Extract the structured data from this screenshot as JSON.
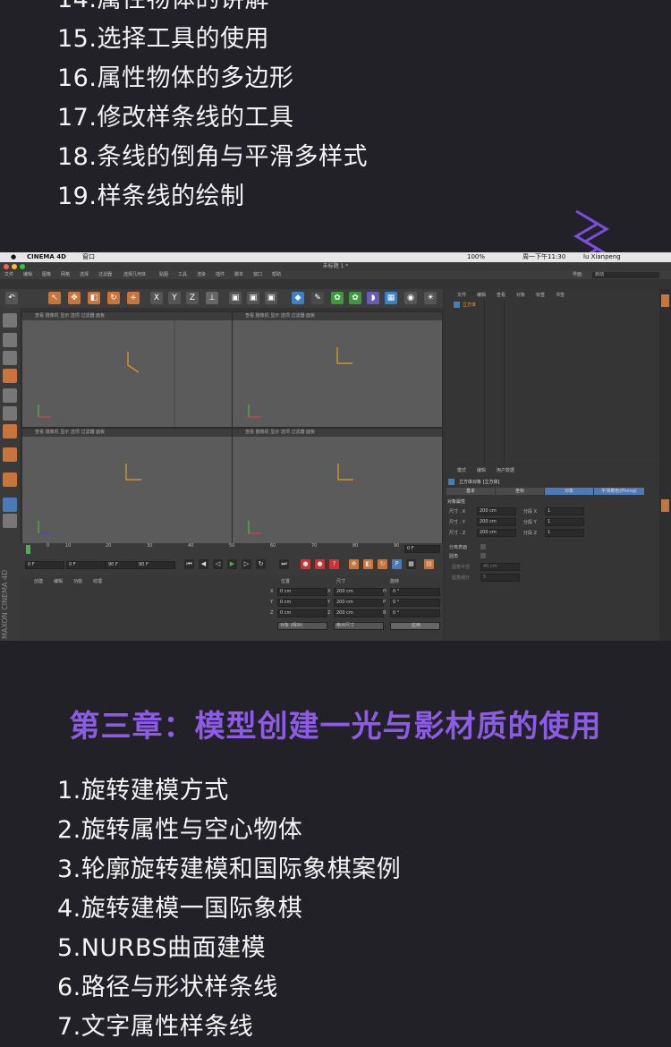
{
  "top_list": [
    "14.属性物体的讲解",
    "15.选择工具的使用",
    "16.属性物体的多边形",
    "17.修改样条线的工具",
    "18.条线的倒角与平滑多样式",
    "19.样条线的绘制"
  ],
  "chapter_title": "第三章：模型创建一光与影材质的使用",
  "bottom_list": [
    "1.旋转建模方式",
    "2.旋转属性与空心物体",
    "3.轮廓旋转建模和国际象棋案例",
    "4.旋转建模一国际象棋",
    "5.NURBS曲面建模",
    "6.路径与形状样条线",
    "7.文字属性样条线"
  ],
  "colors": {
    "accent": "#8c5ce6",
    "background": "#222128"
  },
  "screenshot": {
    "mac_menu": {
      "app": "CINEMA 4D",
      "window": "窗口",
      "battery": "100%",
      "clock": "周一下午11:30",
      "user": "lu Xianpeng"
    },
    "window_title": "未标题 1 *",
    "menus": [
      "文件",
      "编辑",
      "查看",
      "对象",
      "标签",
      "书签"
    ],
    "main_menus": [
      "文件",
      "编辑",
      "图像",
      "网格",
      "选择",
      "过滤器",
      "选择几何体",
      "贴图",
      "工具",
      "渲染",
      "插件",
      "脚本",
      "窗口",
      "帮助"
    ],
    "layout_label": "界面:",
    "layout_value": "启动",
    "viewport_menu": [
      "查看",
      "摄像机",
      "显示",
      "选项",
      "过滤器",
      "面板"
    ],
    "object_name": "立方体",
    "attr_menu": [
      "模式",
      "编辑",
      "用户数据"
    ],
    "attr_title": "立方体对象 [立方体]",
    "attr_tabs": [
      "基本",
      "坐标",
      "对象",
      "平滑着色(Phong)"
    ],
    "attr_section": "对象属性",
    "attr_fields": [
      {
        "label": "尺寸 . X",
        "value": "200 cm",
        "seg_label": "分段 X",
        "seg": "1"
      },
      {
        "label": "尺寸 . Y",
        "value": "200 cm",
        "seg_label": "分段 Y",
        "seg": "1"
      },
      {
        "label": "尺寸 . Z",
        "value": "200 cm",
        "seg_label": "分段 Z",
        "seg": "1"
      }
    ],
    "attr_checks": [
      "分离表面",
      "圆角",
      "圆角半径",
      "圆角细分"
    ],
    "fillet_radius": "40 cm",
    "fillet_sub": "5",
    "timeline_ticks": [
      "0",
      "10",
      "20",
      "30",
      "40",
      "50",
      "60",
      "70",
      "80",
      "90"
    ],
    "frame_end": "0 F",
    "time_fields": [
      "0 F",
      "0 F",
      "90 F",
      "90 F"
    ],
    "material_menu": [
      "创建",
      "编辑",
      "功能",
      "纹理"
    ],
    "coord_headers": [
      "位置",
      "尺寸",
      "旋转"
    ],
    "coords": [
      {
        "axis": "X",
        "pos": "0 cm",
        "size": "200 cm",
        "rot_label": "H",
        "rot": "0 °"
      },
      {
        "axis": "Y",
        "pos": "0 cm",
        "size": "200 cm",
        "rot_label": "P",
        "rot": "0 °"
      },
      {
        "axis": "Z",
        "pos": "0 cm",
        "size": "200 cm",
        "rot_label": "B",
        "rot": "0 °"
      }
    ],
    "coord_mode": "对象 (相对)",
    "coord_size_mode": "绝对尺寸",
    "apply_label": "应用",
    "brand": "MAXON CINEMA 4D"
  }
}
